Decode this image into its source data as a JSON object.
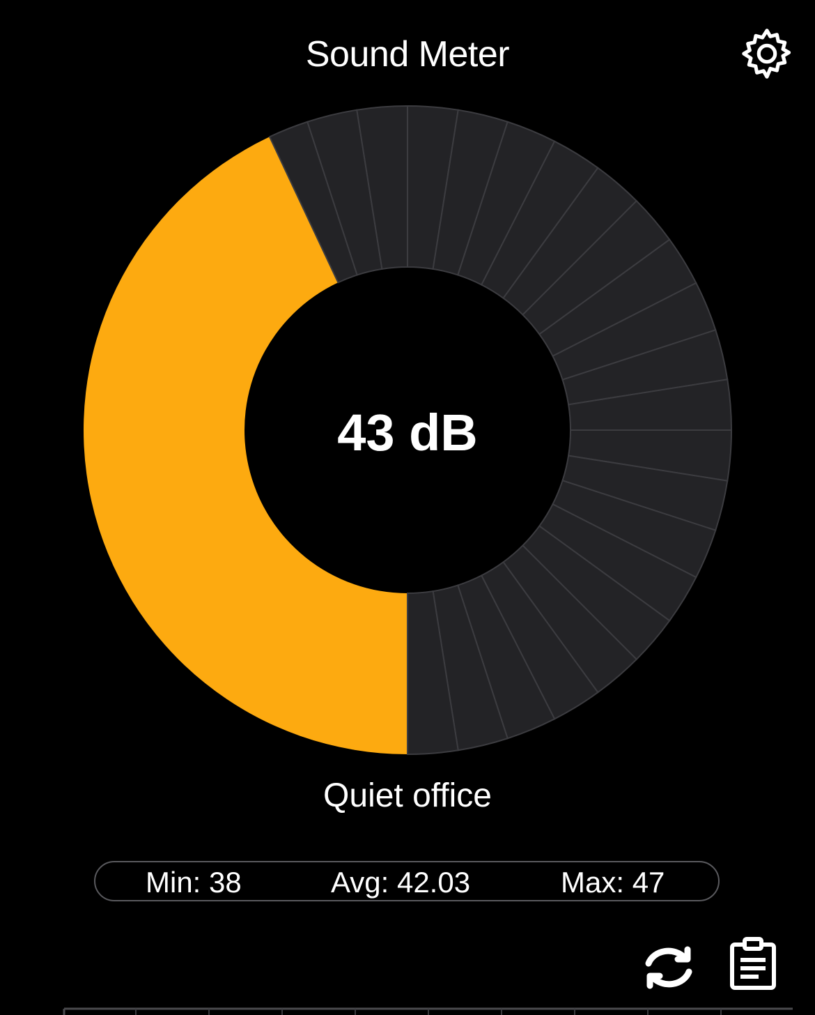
{
  "header": {
    "title": "Sound Meter",
    "settings_icon": "gear-icon"
  },
  "gauge": {
    "value": 43,
    "display": "43 dB",
    "min_db": 0,
    "max_db": 100,
    "segments": 40,
    "description": "Quiet office",
    "colors": {
      "active": "#FDAA10",
      "inactive": "#232326",
      "segment_divider": "#3c3c40"
    }
  },
  "stats": {
    "min_label": "Min:",
    "min_value": "38",
    "avg_label": "Avg:",
    "avg_value": "42.03",
    "max_label": "Max:",
    "max_value": "47"
  },
  "actions": {
    "reset_icon": "refresh-icon",
    "clipboard_icon": "clipboard-icon"
  }
}
